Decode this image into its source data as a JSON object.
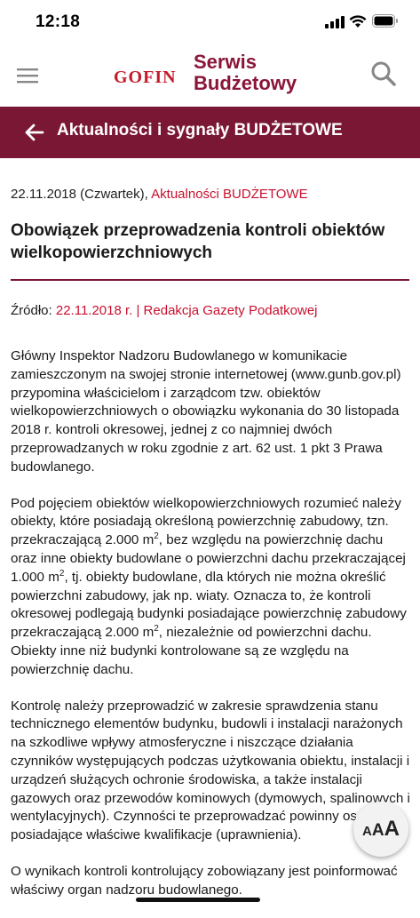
{
  "status_bar": {
    "time": "12:18"
  },
  "header": {
    "brand_gofin": "GOFIN",
    "brand_line1": "Serwis",
    "brand_line2": "Budżetowy"
  },
  "section": {
    "title": "Aktualności i sygnały BUDŻETOWE"
  },
  "article": {
    "date": "22.11.2018 (Czwartek),",
    "category": "Aktualności BUDŻETOWE",
    "title": "Obowiązek przeprowadzenia kontroli obiektów wielkopowierzchniowych",
    "source_label": "Źródło:",
    "source_value": "22.11.2018 r. | Redakcja Gazety Podatkowej",
    "p1": "Główny Inspektor Nadzoru Budowlanego w komunikacie zamieszczonym na swojej stronie internetowej (www.gunb.gov.pl) przypomina właścicielom i zarządcom tzw. obiektów wielkopowierzchniowych o obowiązku wykonania do 30 listopada 2018 r. kontroli okresowej, jednej z co najmniej dwóch przeprowadzanych w roku zgodnie z art. 62 ust. 1 pkt 3 Prawa budowlanego.",
    "p2_a": "Pod pojęciem obiektów wielkopowierzchniowych rozumieć należy obiekty, które posiadają określoną powierzchnię zabudowy, tzn. przekraczającą 2.000 m",
    "p2_b": ", bez względu na powierzchnię dachu oraz inne obiekty budowlane o powierzchni dachu przekraczającej 1.000 m",
    "p2_c": ", tj. obiekty budowlane, dla których nie można określić powierzchni zabudowy, jak np. wiaty. Oznacza to, że kontroli okresowej podlegają budynki posiadające powierzchnię zabudowy przekraczającą 2.000 m",
    "p2_d": ", niezależnie od powierzchni dachu. Obiekty inne niż budynki kontrolowane są ze względu na powierzchnię dachu.",
    "sup": "2",
    "p3": "Kontrolę należy przeprowadzić w zakresie sprawdzenia stanu technicznego elementów budynku, budowli i instalacji narażonych na szkodliwe wpływy atmosferyczne i niszczące działania czynników występujących podczas użytkowania obiektu, instalacji i urządzeń służących ochronie środowiska, a także instalacji gazowych oraz przewodów kominowych (dymowych, spalinowych i wentylacyjnych). Czynności te przeprowadzać powinny osoby posiadające właściwe kwalifikacje (uprawnienia).",
    "p4": "O wynikach kontroli kontrolujący zobowiązany jest poinformować właściwy organ nadzoru budowlanego."
  },
  "font_button": {
    "a1": "A",
    "a2": "A",
    "a3": "A"
  },
  "colors": {
    "brand": "#7a1735",
    "accent_red": "#c8102e",
    "gofin_red": "#c41b2b"
  }
}
